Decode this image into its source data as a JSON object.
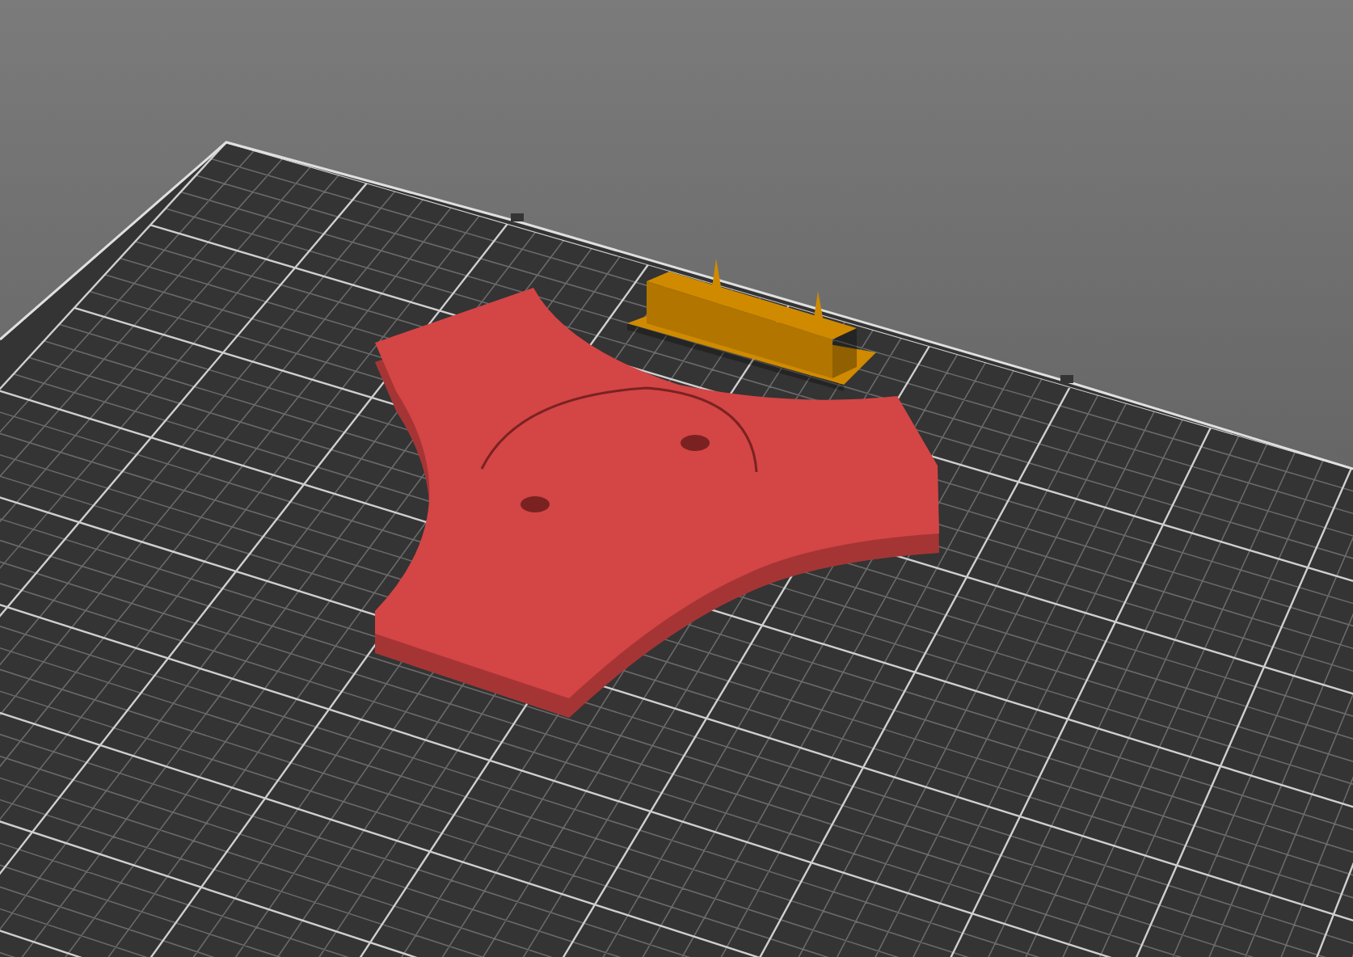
{
  "viewport": {
    "objects": [
      {
        "kind": "spinner",
        "color": "#d44545"
      },
      {
        "kind": "bracket",
        "color": "#d08a00"
      }
    ]
  }
}
